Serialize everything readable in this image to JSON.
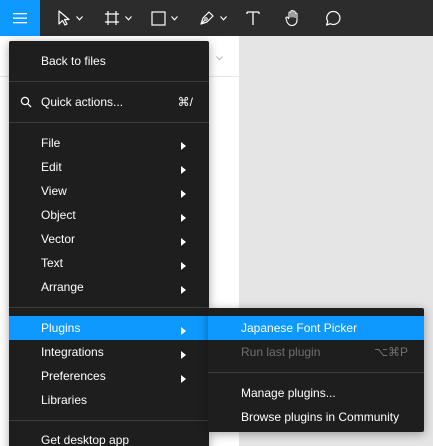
{
  "colors": {
    "accent": "#0d99ff",
    "toolbar_bg": "#2c2c2c",
    "menu_bg": "#1e1e1e",
    "disabled_text": "#6f6f6f"
  },
  "toolbar": {
    "icons": [
      "hamburger-menu-icon",
      "move-tool-icon",
      "frame-tool-icon",
      "shape-tool-icon",
      "pen-tool-icon",
      "text-tool-icon",
      "hand-tool-icon",
      "comment-tool-icon"
    ]
  },
  "main_menu": {
    "back_to_files": "Back to files",
    "quick_actions": {
      "label": "Quick actions...",
      "shortcut": "⌘/"
    },
    "items": [
      {
        "label": "File",
        "has_submenu": true
      },
      {
        "label": "Edit",
        "has_submenu": true
      },
      {
        "label": "View",
        "has_submenu": true
      },
      {
        "label": "Object",
        "has_submenu": true
      },
      {
        "label": "Vector",
        "has_submenu": true
      },
      {
        "label": "Text",
        "has_submenu": true
      },
      {
        "label": "Arrange",
        "has_submenu": true
      }
    ],
    "plugins": "Plugins",
    "integrations": "Integrations",
    "preferences": "Preferences",
    "libraries": "Libraries",
    "get_desktop_app": "Get desktop app"
  },
  "plugins_submenu": {
    "japanese_font_picker": "Japanese Font Picker",
    "run_last_plugin": {
      "label": "Run last plugin",
      "shortcut": "⌥⌘P"
    },
    "manage_plugins": "Manage plugins...",
    "browse_plugins": "Browse plugins in Community"
  }
}
